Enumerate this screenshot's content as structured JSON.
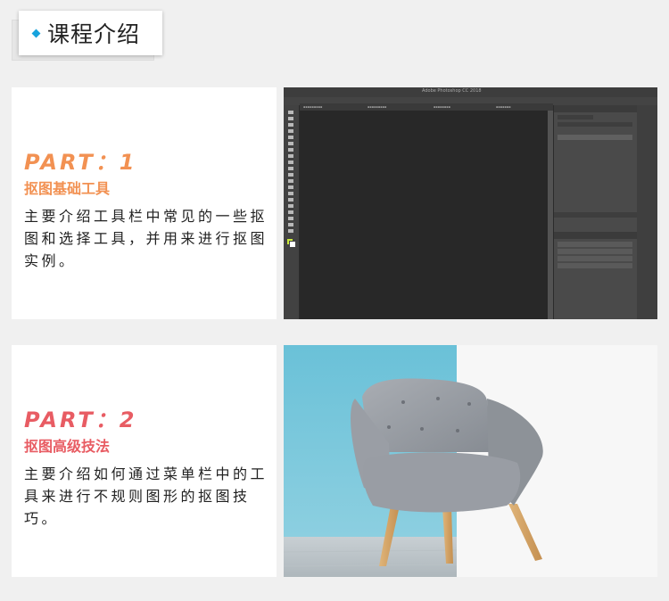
{
  "header": {
    "title": "课程介绍",
    "accent_color": "#17a3dd"
  },
  "sections": [
    {
      "part": "PART：1",
      "subtitle": "抠图基础工具",
      "description": "主要介绍工具栏中常见的一些抠图和选择工具，并用来进行抠图实例。",
      "color": "#f29152",
      "image": "photoshop-screenshot"
    },
    {
      "part": "PART：2",
      "subtitle": "抠图高级技法",
      "description": "主要介绍如何通过菜单栏中的工具来进行不规则图形的抠图技巧。",
      "color": "#e85c63",
      "image": "chair-photo"
    }
  ],
  "photoshop": {
    "app_title": "Adobe Photoshop CC 2018"
  }
}
